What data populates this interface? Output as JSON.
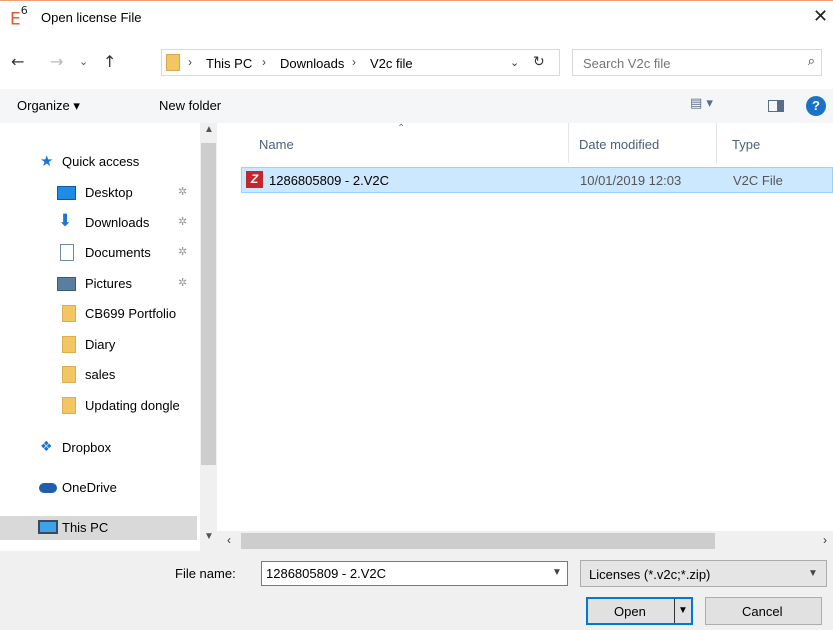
{
  "window": {
    "app_logo": "E",
    "app_logo_sup": "6",
    "title": "Open license File",
    "close_glyph": "✕"
  },
  "address": {
    "back": "←",
    "forward": "→",
    "recent": "⌄",
    "up": "↑",
    "breadcrumbs": [
      "This PC",
      "Downloads",
      "V2c file"
    ],
    "separator": "›",
    "dropdown": "⌄",
    "refresh": "↻"
  },
  "search": {
    "placeholder": "Search V2c file",
    "icon": "⌕"
  },
  "toolbar": {
    "organize_label": "Organize ▾",
    "new_folder_label": "New folder",
    "view_label": "▤ ▾",
    "help_label": "?"
  },
  "nav": {
    "items": [
      {
        "label": "Quick access",
        "icon": "star-icon"
      },
      {
        "label": "Desktop",
        "icon": "desktop-icon",
        "pinned": true
      },
      {
        "label": "Downloads",
        "icon": "download-icon",
        "pinned": true
      },
      {
        "label": "Documents",
        "icon": "documents-icon",
        "pinned": true
      },
      {
        "label": "Pictures",
        "icon": "pictures-icon",
        "pinned": true
      },
      {
        "label": "CB699 Portfolio",
        "icon": "folder-icon"
      },
      {
        "label": "Diary",
        "icon": "folder-icon"
      },
      {
        "label": "sales",
        "icon": "folder-icon"
      },
      {
        "label": "Updating dongle",
        "icon": "folder-icon"
      },
      {
        "label": "Dropbox",
        "icon": "dropbox-icon"
      },
      {
        "label": "OneDrive",
        "icon": "onedrive-icon"
      },
      {
        "label": "This PC",
        "icon": "this-pc-icon"
      }
    ],
    "pin_glyph": "✲"
  },
  "columns": {
    "name": "Name",
    "date": "Date modified",
    "type": "Type"
  },
  "files": [
    {
      "name": "1286805809 - 2.V2C",
      "date": "10/01/2019 12:03",
      "type": "V2C File",
      "icon_letter": "Z",
      "icon_color": "#c1272d"
    }
  ],
  "bottom": {
    "filename_label": "File name:",
    "filename_value": "1286805809 - 2.V2C",
    "filter_value": "Licenses (*.v2c;*.zip)",
    "open_label": "Open",
    "cancel_label": "Cancel"
  },
  "colors": {
    "selection": "#cce8ff",
    "accent": "#0078d7",
    "folder": "#f3c664"
  }
}
